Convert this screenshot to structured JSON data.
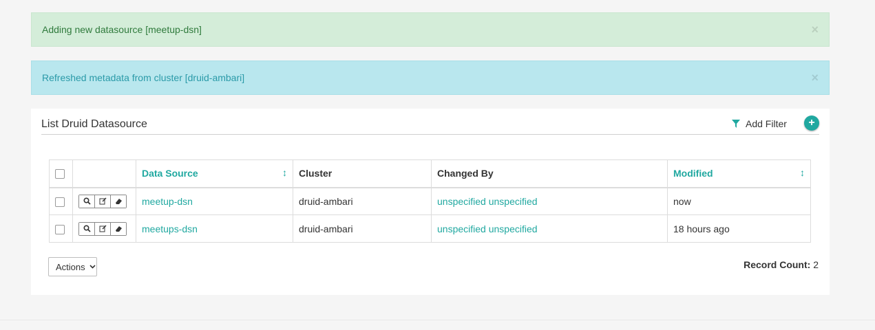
{
  "alerts": [
    {
      "text": "Adding new datasource [meetup-dsn]",
      "type": "success",
      "close": "×"
    },
    {
      "text": "Refreshed metadata from cluster [druid-ambari]",
      "type": "info",
      "close": "×"
    }
  ],
  "panel": {
    "title": "List Druid Datasource",
    "add_filter_label": "Add Filter",
    "add_button_label": "+"
  },
  "table": {
    "columns": [
      "",
      "",
      "Data Source",
      "Cluster",
      "Changed By",
      "Modified"
    ],
    "rows": [
      {
        "data_source": "meetup-dsn",
        "cluster": "druid-ambari",
        "changed_by": "unspecified unspecified",
        "modified": "now"
      },
      {
        "data_source": "meetups-dsn",
        "cluster": "druid-ambari",
        "changed_by": "unspecified unspecified",
        "modified": "18 hours ago"
      }
    ]
  },
  "footer": {
    "actions_label": "Actions",
    "record_count_label": "Record Count:",
    "record_count_value": "2"
  },
  "colors": {
    "accent": "#20a8a0",
    "success_bg": "#d4edd9",
    "info_bg": "#b9e7ee"
  }
}
